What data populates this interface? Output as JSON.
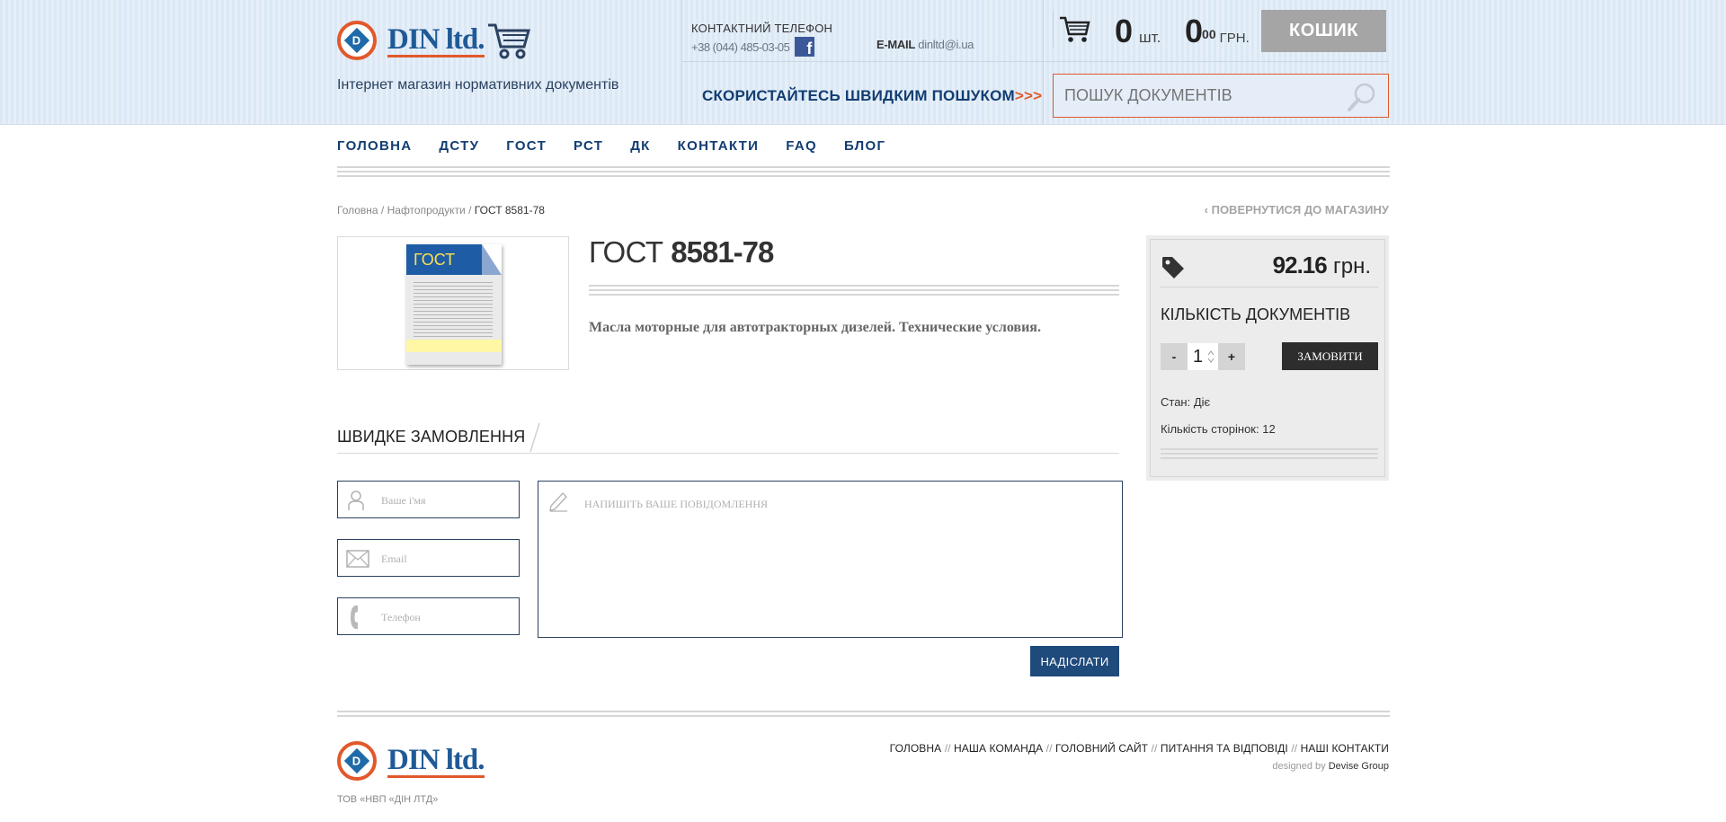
{
  "header": {
    "logo_text": "DIN ltd.",
    "logo_letter": "D",
    "slogan": "Інтернет магазин нормативних документів",
    "contact_label": "КОНТАКТНИЙ ТЕЛЕФОН",
    "phone": "+38 (044) 485-03-05",
    "facebook_letter": "f",
    "email_label": "E-MAIL",
    "email": "dinltd@i.ua",
    "quick_search": "СКОРИСТАЙТЕСЬ ШВИДКИМ ПОШУКОМ",
    "quick_search_arrows": ">>>",
    "search_placeholder": "ПОШУК ДОКУМЕНТІВ",
    "cart_count": "0",
    "cart_count_unit": "шт.",
    "cart_sum": "0",
    "cart_sum_cents": "00",
    "cart_sum_unit": "ГРН.",
    "cart_button": "КОШИК"
  },
  "nav": {
    "items": [
      "ГОЛОВНА",
      "ДСТУ",
      "ГОСТ",
      "РСТ",
      "ДК",
      "КОНТАКТИ",
      "FAQ",
      "БЛОГ"
    ]
  },
  "breadcrumb": {
    "home": "Головна",
    "category": "Нафтопродукти",
    "current": "ГОСТ 8581-78",
    "sep": " / "
  },
  "back_link": "‹ ПОВЕРНУТИСЯ ДО МАГАЗИНУ",
  "product": {
    "image_label": "ГОСТ",
    "title_prefix": "ГОСТ",
    "title_number": "8581-78",
    "description": "Масла моторные для автотракторных дизелей. Технические условия."
  },
  "quick_order": {
    "title": "ШВИДКЕ ЗАМОВЛЕННЯ",
    "name_placeholder": "Ваше і'мя",
    "email_placeholder": "Email",
    "phone_placeholder": "Телефон",
    "message_placeholder": "НАПИШІТЬ ВАШЕ ПОВІДОМЛЕННЯ",
    "send_button": "НАДІСЛАТИ"
  },
  "price_box": {
    "price": "92.16",
    "currency": "грн.",
    "qty_label": "КІЛЬКІСТЬ ДОКУМЕНТІВ",
    "minus": "-",
    "qty": "1",
    "plus": "+",
    "order_button": "ЗАМОВИТИ",
    "status": "Стан: Діє",
    "pages": "Кількість сторінок: 12"
  },
  "footer": {
    "logo_text": "DIN ltd.",
    "logo_letter": "D",
    "links": [
      "ГОЛОВНА",
      "НАША КОМАНДА",
      "ГОЛОВНИЙ САЙТ",
      "ПИТАННЯ ТА ВІДПОВІДІ",
      "НАШІ КОНТАКТИ"
    ],
    "link_sep": "//",
    "designed_by_label": "designed by",
    "designed_by": "Devise Group",
    "company": "ТОВ «НВП «ДІН ЛТД»"
  },
  "colors": {
    "accent_orange": "#e2582a",
    "brand_blue": "#1f5a97",
    "nav_blue": "#123d72",
    "send_button": "#1f4a7c"
  }
}
